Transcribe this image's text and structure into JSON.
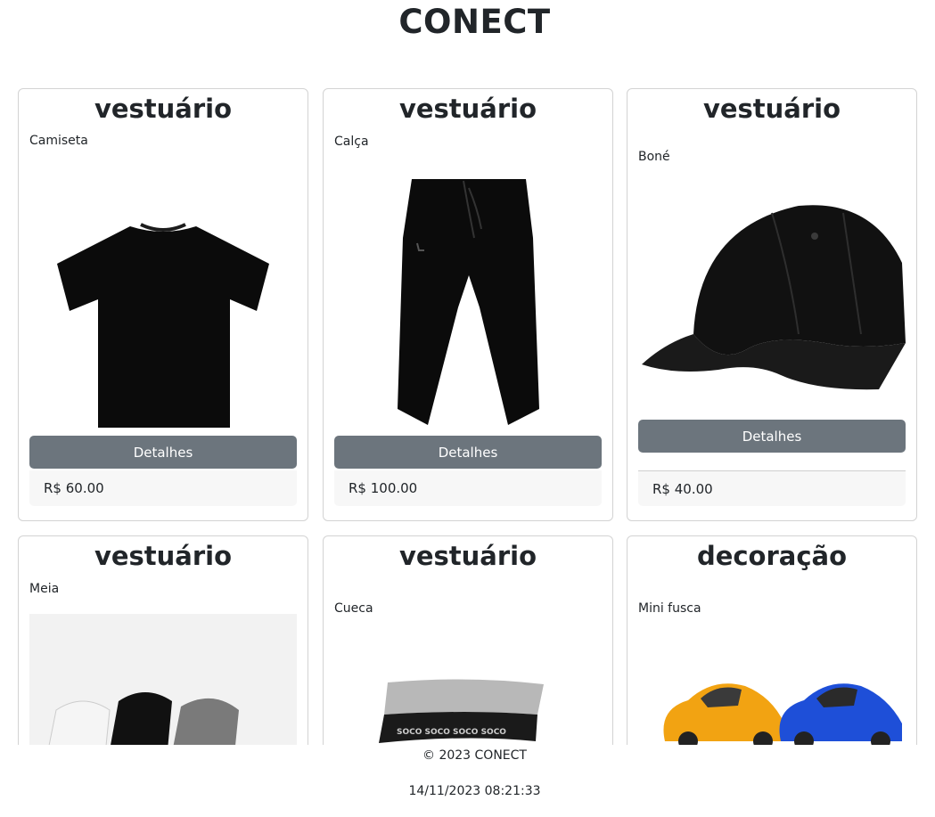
{
  "site": {
    "title": "CONECT"
  },
  "products": [
    {
      "category": "vestuário",
      "name": "Camiseta",
      "button": "Detalhes",
      "price": "R$ 60.00",
      "icon": "tshirt-image"
    },
    {
      "category": "vestuário",
      "name": "Calça",
      "button": "Detalhes",
      "price": "R$ 100.00",
      "icon": "pants-image"
    },
    {
      "category": "vestuário",
      "name": "Boné",
      "button": "Detalhes",
      "price": "R$ 40.00",
      "icon": "cap-image"
    },
    {
      "category": "vestuário",
      "name": "Meia",
      "icon": "socks-image"
    },
    {
      "category": "vestuário",
      "name": "Cueca",
      "icon": "underwear-image"
    },
    {
      "category": "decoração",
      "name": "Mini fusca",
      "icon": "toy-car-image"
    }
  ],
  "footer": {
    "copyright": "© 2023 CONECT",
    "timestamp": "14/11/2023 08:21:33"
  },
  "colors": {
    "button": "#6c757d",
    "price_bg": "#f7f7f7",
    "card_border": "#d3d3d3"
  }
}
